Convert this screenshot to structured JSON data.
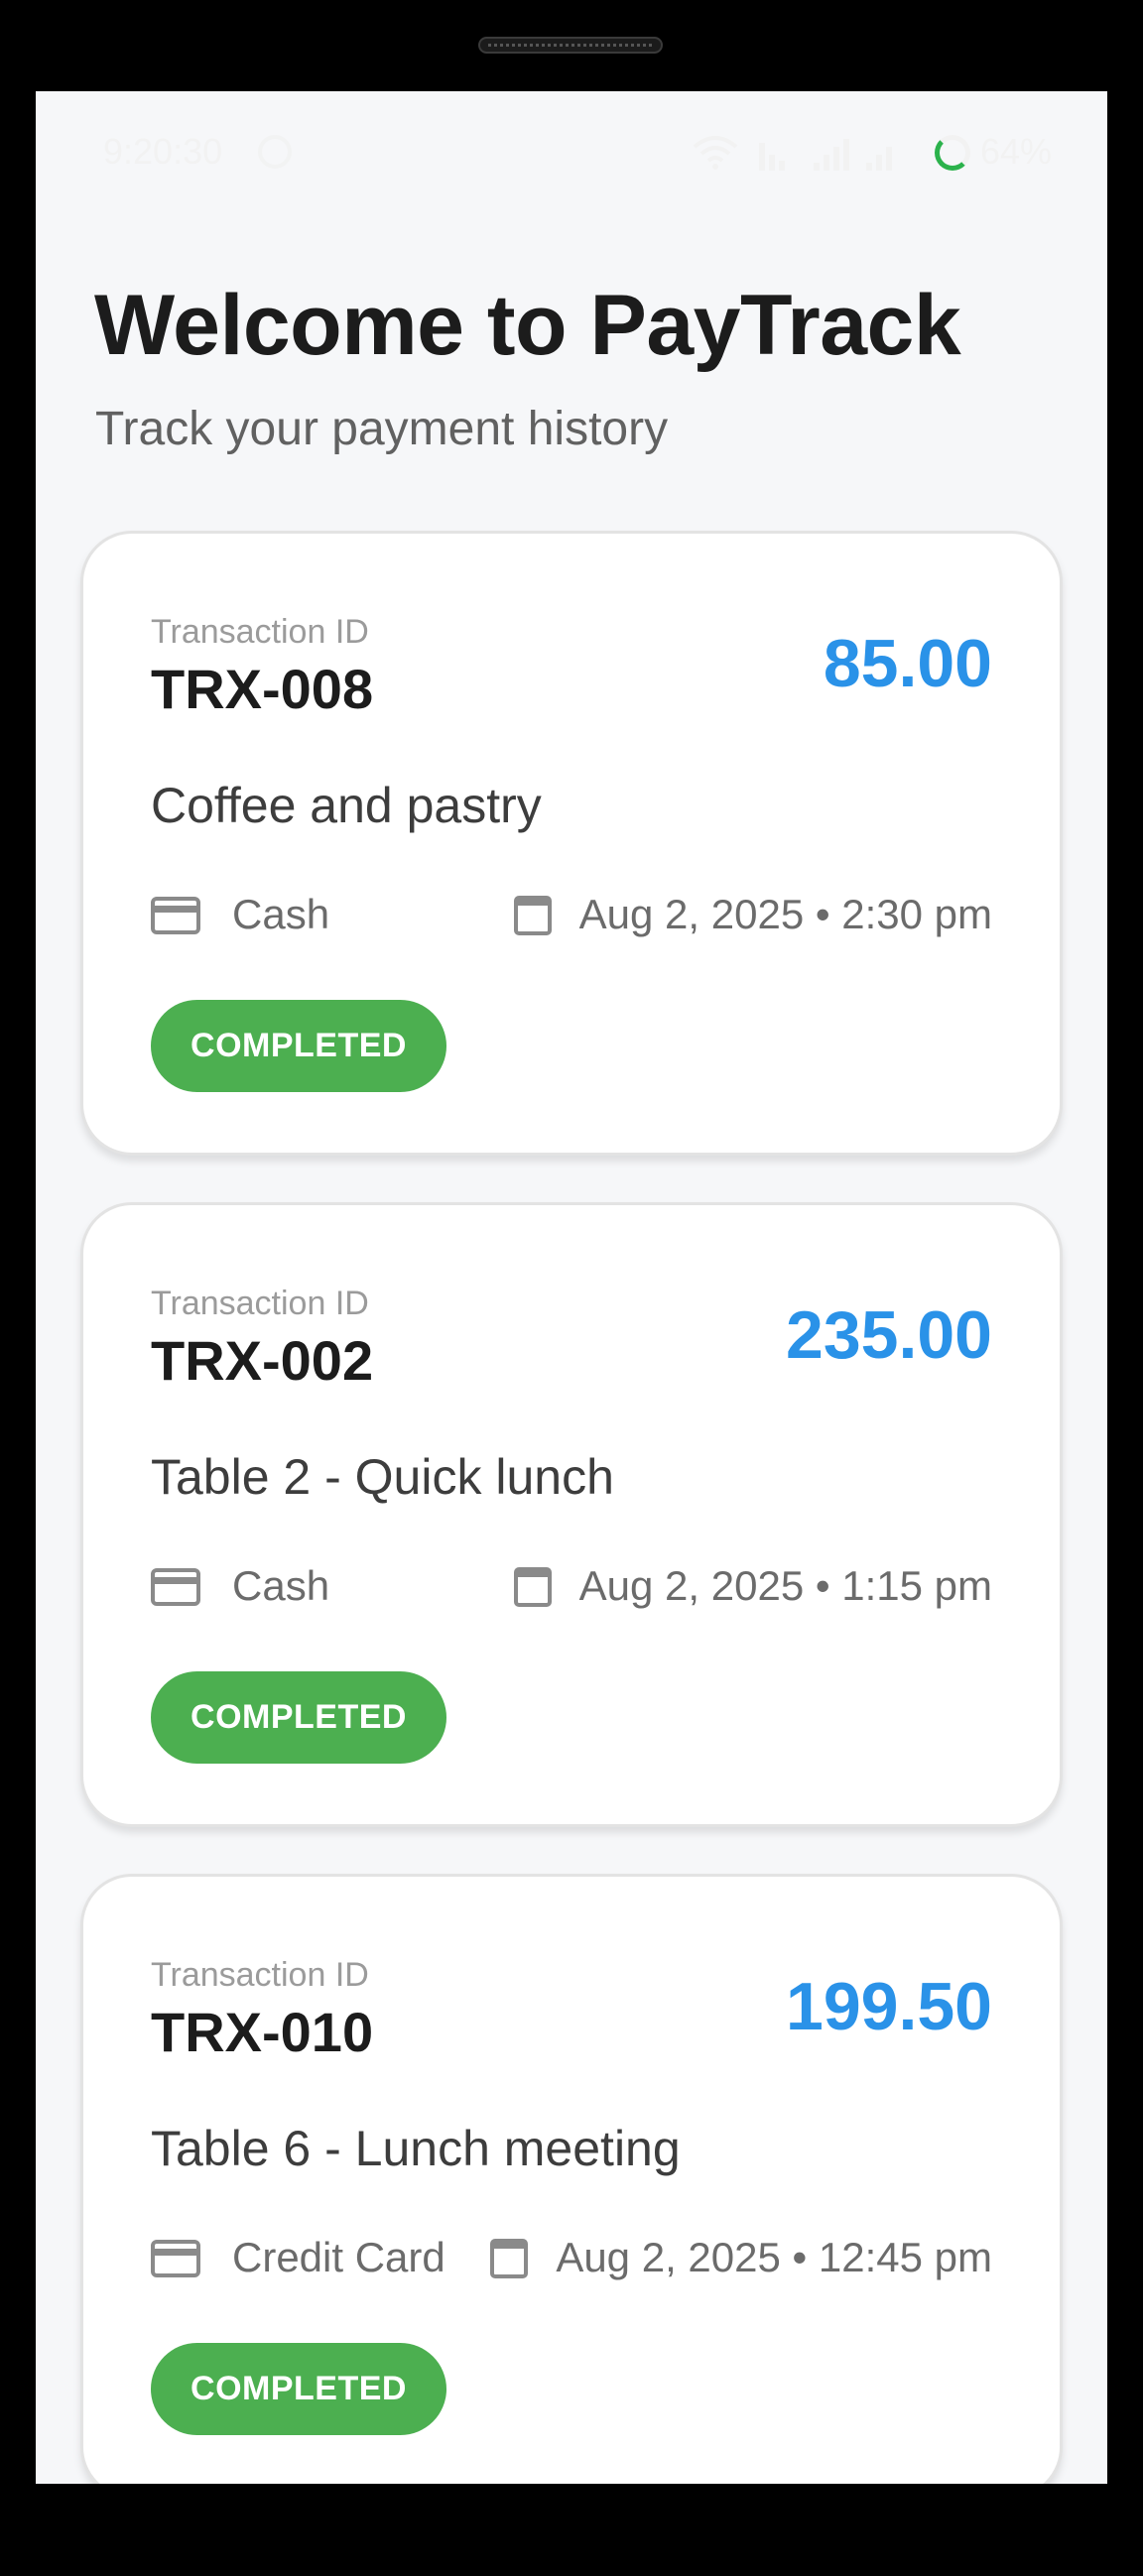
{
  "status_bar": {
    "time": "9:20:30",
    "battery": "64%"
  },
  "header": {
    "title": "Welcome to PayTrack",
    "subtitle": "Track your payment history"
  },
  "transactions": [
    {
      "label": "Transaction ID",
      "id": "TRX-008",
      "amount": "85.00",
      "description": "Coffee and pastry",
      "method": "Cash",
      "date": "Aug 2, 2025 • 2:30 pm",
      "status": "COMPLETED"
    },
    {
      "label": "Transaction ID",
      "id": "TRX-002",
      "amount": "235.00",
      "description": "Table 2 - Quick lunch",
      "method": "Cash",
      "date": "Aug 2, 2025 • 1:15 pm",
      "status": "COMPLETED"
    },
    {
      "label": "Transaction ID",
      "id": "TRX-010",
      "amount": "199.50",
      "description": "Table 6 - Lunch meeting",
      "method": "Credit Card",
      "date": "Aug 2, 2025 • 12:45 pm",
      "status": "COMPLETED"
    }
  ],
  "colors": {
    "accent_amount": "#2a92e8",
    "status_completed": "#4caf50",
    "background": "#f6f7f9"
  },
  "icons": {
    "method": "credit-card-icon",
    "date": "calendar-icon"
  }
}
